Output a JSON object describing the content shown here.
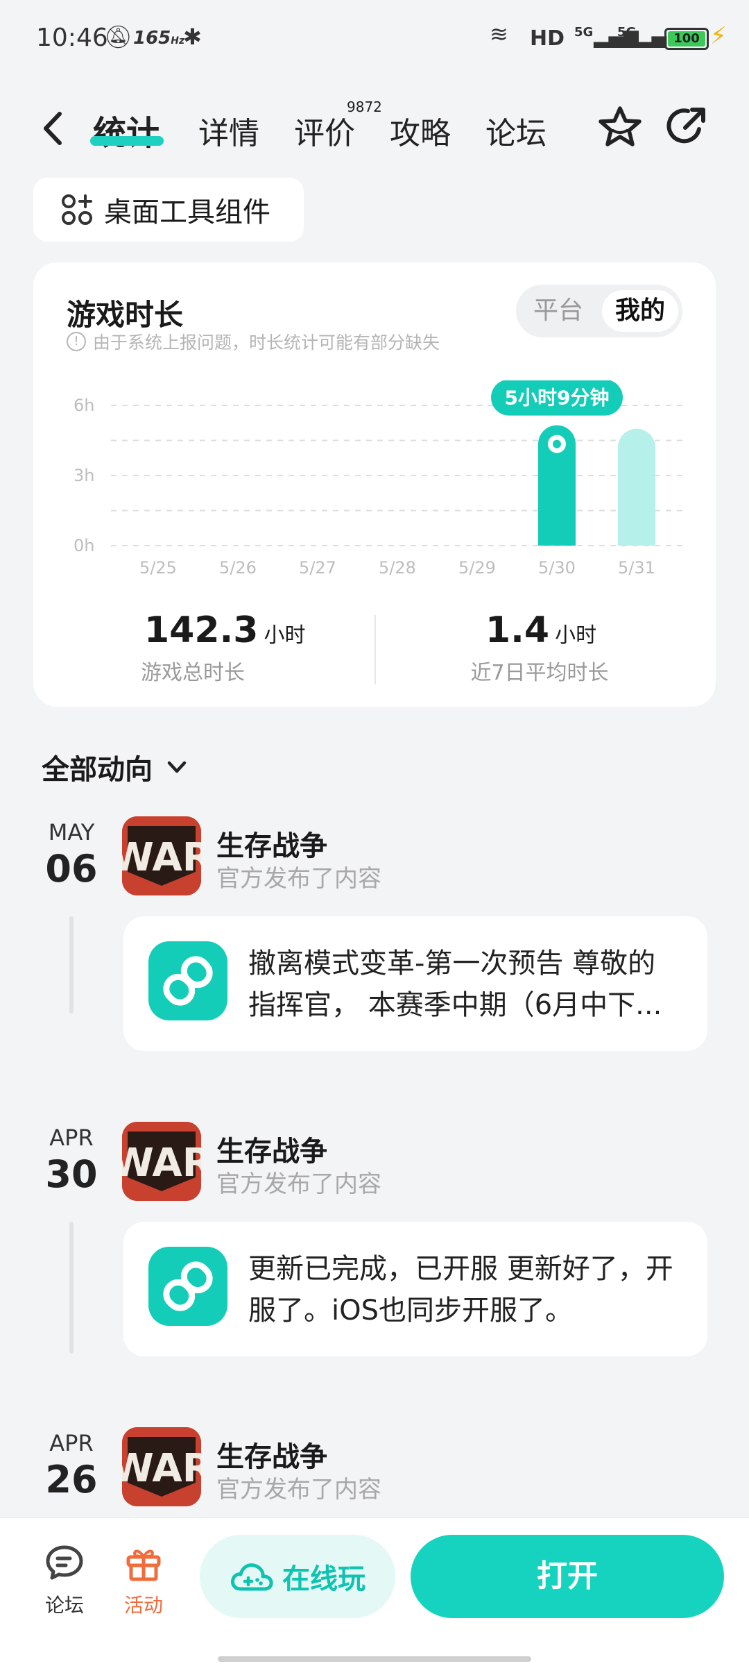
{
  "status_bar": {
    "time": "10:46",
    "refresh_rate": "165",
    "refresh_unit": "Hz",
    "network": "HD",
    "signal1": "5G",
    "signal2": "5G",
    "battery": "100"
  },
  "nav": {
    "tabs": [
      {
        "label": "统计",
        "active": true
      },
      {
        "label": "详情",
        "active": false
      },
      {
        "label": "评价",
        "active": false
      },
      {
        "label": "攻略",
        "active": false
      },
      {
        "label": "论坛",
        "active": false
      }
    ],
    "review_count": "9872"
  },
  "widget_button": {
    "label": "桌面工具组件"
  },
  "stats_card": {
    "title": "游戏时长",
    "note": "由于系统上报问题，时长统计可能有部分缺失",
    "toggle": {
      "platform": "平台",
      "mine": "我的"
    },
    "total": {
      "value": "142.3",
      "unit": "小时",
      "label": "游戏总时长"
    },
    "avg": {
      "value": "1.4",
      "unit": "小时",
      "label": "近7日平均时长"
    }
  },
  "chart_data": {
    "type": "bar",
    "categories": [
      "5/25",
      "5/26",
      "5/27",
      "5/28",
      "5/29",
      "5/30",
      "5/31"
    ],
    "values": [
      0,
      0,
      0,
      0,
      0,
      5.15,
      5.0
    ],
    "yticks": [
      "6h",
      "3h",
      "0h"
    ],
    "ylim": [
      0,
      6
    ],
    "selected_index": 5,
    "tooltip": "5小时9分钟",
    "colors": {
      "bar": "#14cdb8",
      "bar_light": "#b5f0ea",
      "tooltip": "#14cdb8"
    }
  },
  "activity": {
    "header": "全部动向",
    "items": [
      {
        "month": "MAY",
        "day": "06",
        "app": "生存战争",
        "sub": "官方发布了内容",
        "text": "撤离模式变革-第一次预告 尊敬的指挥官， 本赛季中期（6月中下..."
      },
      {
        "month": "APR",
        "day": "30",
        "app": "生存战争",
        "sub": "官方发布了内容",
        "text": "更新已完成，已开服 更新好了，开服了。iOS也同步开服了。"
      },
      {
        "month": "APR",
        "day": "26",
        "app": "生存战争",
        "sub": "官方发布了内容",
        "text": ""
      }
    ]
  },
  "bottom_bar": {
    "forum": "论坛",
    "activity": "活动",
    "online_play": "在线玩",
    "open": "打开"
  },
  "colors": {
    "accent": "#14cdb8",
    "activity_orange": "#f26b3a",
    "app_icon_red": "#c8402e"
  }
}
